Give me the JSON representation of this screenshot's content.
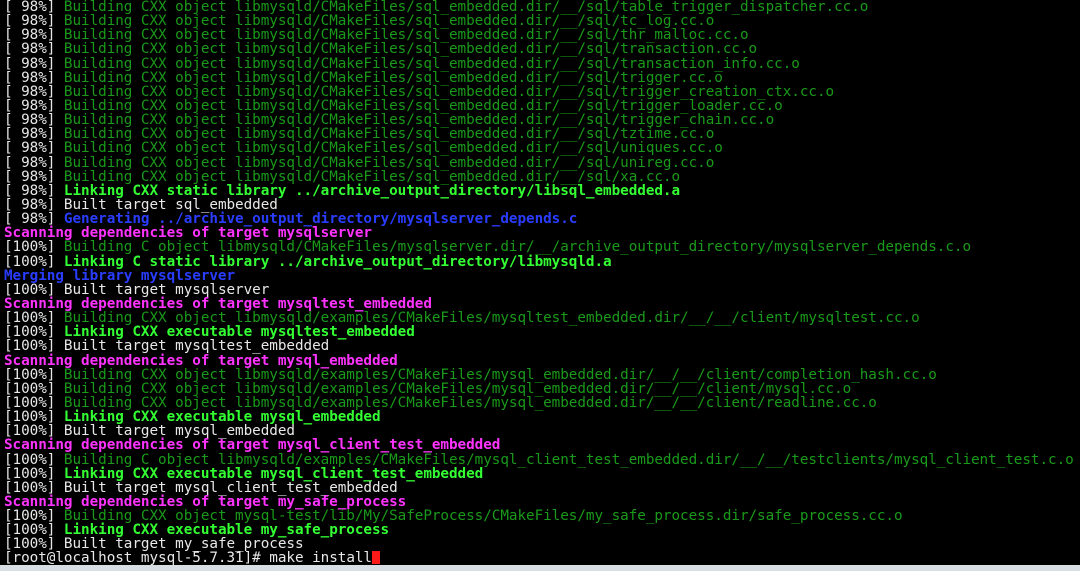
{
  "colors": {
    "background": "#000000",
    "white": "#e8e8e8",
    "green_dim": "#1a9a1a",
    "green_bold": "#33ff33",
    "magenta": "#ff33ff",
    "blue": "#2a3dff",
    "cursor": "#ff1a1a"
  },
  "terminal": {
    "lines": [
      {
        "prefix": "[ 98%] ",
        "text": "Building CXX object libmysqld/CMakeFiles/sql_embedded.dir/__/sql/table_trigger_dispatcher.cc.o",
        "style": "green-dim"
      },
      {
        "prefix": "[ 98%] ",
        "text": "Building CXX object libmysqld/CMakeFiles/sql_embedded.dir/__/sql/tc_log.cc.o",
        "style": "green-dim"
      },
      {
        "prefix": "[ 98%] ",
        "text": "Building CXX object libmysqld/CMakeFiles/sql_embedded.dir/__/sql/thr_malloc.cc.o",
        "style": "green-dim"
      },
      {
        "prefix": "[ 98%] ",
        "text": "Building CXX object libmysqld/CMakeFiles/sql_embedded.dir/__/sql/transaction.cc.o",
        "style": "green-dim"
      },
      {
        "prefix": "[ 98%] ",
        "text": "Building CXX object libmysqld/CMakeFiles/sql_embedded.dir/__/sql/transaction_info.cc.o",
        "style": "green-dim"
      },
      {
        "prefix": "[ 98%] ",
        "text": "Building CXX object libmysqld/CMakeFiles/sql_embedded.dir/__/sql/trigger.cc.o",
        "style": "green-dim"
      },
      {
        "prefix": "[ 98%] ",
        "text": "Building CXX object libmysqld/CMakeFiles/sql_embedded.dir/__/sql/trigger_creation_ctx.cc.o",
        "style": "green-dim"
      },
      {
        "prefix": "[ 98%] ",
        "text": "Building CXX object libmysqld/CMakeFiles/sql_embedded.dir/__/sql/trigger_loader.cc.o",
        "style": "green-dim"
      },
      {
        "prefix": "[ 98%] ",
        "text": "Building CXX object libmysqld/CMakeFiles/sql_embedded.dir/__/sql/trigger_chain.cc.o",
        "style": "green-dim"
      },
      {
        "prefix": "[ 98%] ",
        "text": "Building CXX object libmysqld/CMakeFiles/sql_embedded.dir/__/sql/tztime.cc.o",
        "style": "green-dim"
      },
      {
        "prefix": "[ 98%] ",
        "text": "Building CXX object libmysqld/CMakeFiles/sql_embedded.dir/__/sql/uniques.cc.o",
        "style": "green-dim"
      },
      {
        "prefix": "[ 98%] ",
        "text": "Building CXX object libmysqld/CMakeFiles/sql_embedded.dir/__/sql/unireg.cc.o",
        "style": "green-dim"
      },
      {
        "prefix": "[ 98%] ",
        "text": "Building CXX object libmysqld/CMakeFiles/sql_embedded.dir/__/sql/xa.cc.o",
        "style": "green-dim"
      },
      {
        "prefix": "[ 98%] ",
        "text": "Linking CXX static library ../archive_output_directory/libsql_embedded.a",
        "style": "green-bold"
      },
      {
        "prefix": "[ 98%] ",
        "text": "Built target sql_embedded",
        "style": "white"
      },
      {
        "prefix": "[ 98%] ",
        "text": "Generating ../archive_output_directory/mysqlserver_depends.c",
        "style": "blue"
      },
      {
        "prefix": "",
        "text": "Scanning dependencies of target mysqlserver",
        "style": "magenta"
      },
      {
        "prefix": "[100%] ",
        "text": "Building C object libmysqld/CMakeFiles/mysqlserver.dir/__/archive_output_directory/mysqlserver_depends.c.o",
        "style": "green-dim"
      },
      {
        "prefix": "[100%] ",
        "text": "Linking C static library ../archive_output_directory/libmysqld.a",
        "style": "green-bold"
      },
      {
        "prefix": "",
        "text": "Merging library mysqlserver",
        "style": "blue"
      },
      {
        "prefix": "[100%] ",
        "text": "Built target mysqlserver",
        "style": "white"
      },
      {
        "prefix": "",
        "text": "Scanning dependencies of target mysqltest_embedded",
        "style": "magenta"
      },
      {
        "prefix": "[100%] ",
        "text": "Building CXX object libmysqld/examples/CMakeFiles/mysqltest_embedded.dir/__/__/client/mysqltest.cc.o",
        "style": "green-dim"
      },
      {
        "prefix": "[100%] ",
        "text": "Linking CXX executable mysqltest_embedded",
        "style": "green-bold"
      },
      {
        "prefix": "[100%] ",
        "text": "Built target mysqltest_embedded",
        "style": "white"
      },
      {
        "prefix": "",
        "text": "Scanning dependencies of target mysql_embedded",
        "style": "magenta"
      },
      {
        "prefix": "[100%] ",
        "text": "Building CXX object libmysqld/examples/CMakeFiles/mysql_embedded.dir/__/__/client/completion_hash.cc.o",
        "style": "green-dim"
      },
      {
        "prefix": "[100%] ",
        "text": "Building CXX object libmysqld/examples/CMakeFiles/mysql_embedded.dir/__/__/client/mysql.cc.o",
        "style": "green-dim"
      },
      {
        "prefix": "[100%] ",
        "text": "Building CXX object libmysqld/examples/CMakeFiles/mysql_embedded.dir/__/__/client/readline.cc.o",
        "style": "green-dim"
      },
      {
        "prefix": "[100%] ",
        "text": "Linking CXX executable mysql_embedded",
        "style": "green-bold"
      },
      {
        "prefix": "[100%] ",
        "text": "Built target mysql_embedded",
        "style": "white"
      },
      {
        "prefix": "",
        "text": "Scanning dependencies of target mysql_client_test_embedded",
        "style": "magenta"
      },
      {
        "prefix": "[100%] ",
        "text": "Building C object libmysqld/examples/CMakeFiles/mysql_client_test_embedded.dir/__/__/testclients/mysql_client_test.c.o",
        "style": "green-dim"
      },
      {
        "prefix": "[100%] ",
        "text": "Linking CXX executable mysql_client_test_embedded",
        "style": "green-bold"
      },
      {
        "prefix": "[100%] ",
        "text": "Built target mysql_client_test_embedded",
        "style": "white"
      },
      {
        "prefix": "",
        "text": "Scanning dependencies of target my_safe_process",
        "style": "magenta"
      },
      {
        "prefix": "[100%] ",
        "text": "Building CXX object mysql-test/lib/My/SafeProcess/CMakeFiles/my_safe_process.dir/safe_process.cc.o",
        "style": "green-dim"
      },
      {
        "prefix": "[100%] ",
        "text": "Linking CXX executable my_safe_process",
        "style": "green-bold"
      },
      {
        "prefix": "[100%] ",
        "text": "Built target my_safe_process",
        "style": "white"
      }
    ],
    "prompt": {
      "text": "[root@localhost mysql-5.7.31]# ",
      "command": "make install"
    }
  }
}
